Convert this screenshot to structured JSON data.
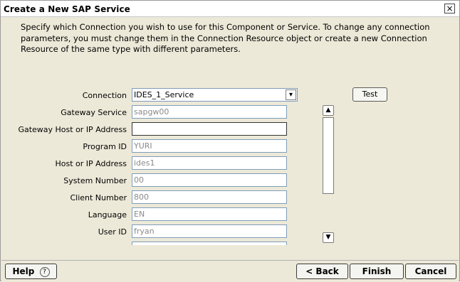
{
  "window": {
    "title": "Create a New SAP Service",
    "close_glyph": "×"
  },
  "description": "Specify which Connection you wish to use for this Component or Service.  To change any connection parameters, you must change them in the Connection Resource object or create a new Connection Resource of the same type with different parameters.",
  "connection": {
    "label": "Connection",
    "value": "IDES_1_Service",
    "dropdown_icon": "chevron-down-icon"
  },
  "test_button": "Test",
  "fields": [
    {
      "label": "Gateway Service",
      "value": "sapgw00"
    },
    {
      "label": "Gateway Host or IP Address",
      "value": ""
    },
    {
      "label": "Program ID",
      "value": "YURI"
    },
    {
      "label": "Host or IP Address",
      "value": "ides1"
    },
    {
      "label": "System Number",
      "value": "00"
    },
    {
      "label": "Client Number",
      "value": "800"
    },
    {
      "label": "Language",
      "value": "EN"
    },
    {
      "label": "User ID",
      "value": "fryan"
    }
  ],
  "scrollbar": {
    "up_glyph": "▲",
    "down_glyph": "▼"
  },
  "footer": {
    "help": "Help",
    "help_icon_glyph": "?",
    "back": "< Back",
    "finish": "Finish",
    "cancel": "Cancel"
  }
}
